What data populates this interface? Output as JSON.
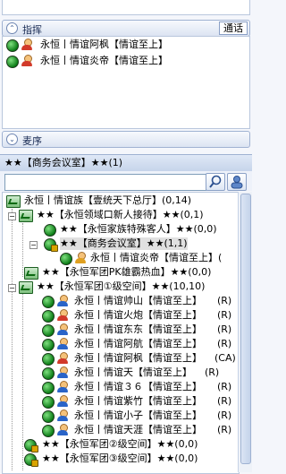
{
  "command": {
    "title": "指挥",
    "tab_label": "通话",
    "members": [
      "永恒丨情谊阿枫【情谊至上】",
      "永恒丨情谊炎帝【情谊至上】"
    ]
  },
  "wheat": {
    "title": "麦序"
  },
  "room": {
    "title": "★★【商务会议室】★★(1)"
  },
  "search": {
    "placeholder": ""
  },
  "tree": {
    "channel_root": {
      "label": "永恒丨情谊族【壹统天下总厅】(0,14)"
    },
    "g1": {
      "label": "★★【永恒领域口新人接待】★★(0,1)"
    },
    "g1a": {
      "label": "★★【永恒家族特殊客人】★★(0,0)"
    },
    "g1b": {
      "label": "★★【商务会议室】★★(1,1)"
    },
    "g1b_user": {
      "label": "永恒丨情谊炎帝【情谊至上】("
    },
    "g2": {
      "label": "★★【永恒军团PK雄霸热血】★★(0,0)"
    },
    "g3": {
      "label": "★★【永恒军团①级空间】★★(10,10)"
    },
    "g3_users": [
      {
        "name": "永恒丨情谊帅山【情谊至上】",
        "tag": "(R)"
      },
      {
        "name": "永恒丨情谊火炮【情谊至上】",
        "tag": "(R)"
      },
      {
        "name": "永恒丨情谊东东【情谊至上】",
        "tag": "(R)"
      },
      {
        "name": "永恒丨情谊阿航【情谊至上】",
        "tag": "(R)"
      },
      {
        "name": "永恒丨情谊阿枫【情谊至上】",
        "tag": "(CA)"
      },
      {
        "name": "永恒丨情谊天【情谊至上】",
        "tag": "(R)"
      },
      {
        "name": "永恒丨情谊３６【情谊至上】",
        "tag": "(R)"
      },
      {
        "name": "永恒丨情谊紫竹【情谊至上】",
        "tag": "(R)"
      },
      {
        "name": "永恒丨情谊小子【情谊至上】",
        "tag": "(R)"
      },
      {
        "name": "永恒丨情谊天涯【情谊至上】",
        "tag": "(R)"
      }
    ],
    "g4": {
      "label": "★★【永恒军团②级空间】★★(0,0)"
    },
    "g5": {
      "label": "★★【永恒军团③级空间】★★(0,0)"
    }
  }
}
